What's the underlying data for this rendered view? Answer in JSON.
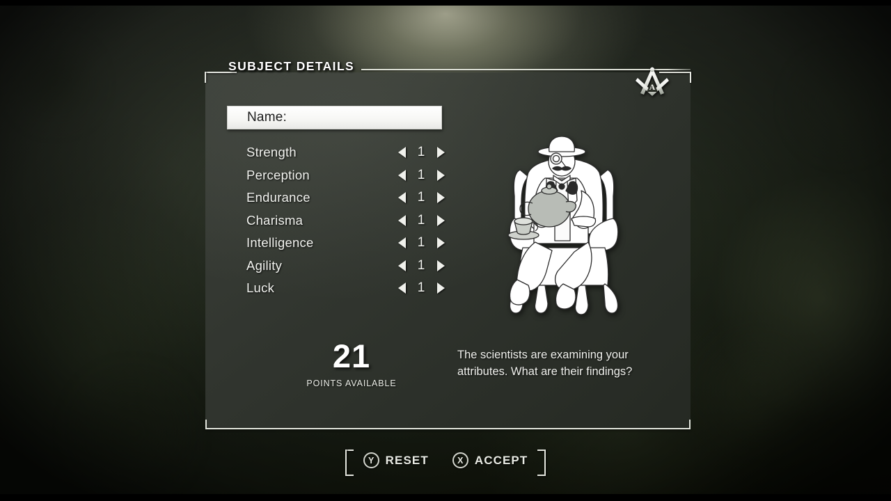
{
  "panel": {
    "title": "SUBJECT DETAILS",
    "emblem_icon": "masonic-square-compass-icon",
    "emblem_center_letter": "A"
  },
  "name_field": {
    "label": "Name:",
    "value": "",
    "placeholder": ""
  },
  "stats": {
    "decrement_icon": "arrow-left-icon",
    "increment_icon": "arrow-right-icon",
    "rows": [
      {
        "label": "Strength",
        "value": "1"
      },
      {
        "label": "Perception",
        "value": "1"
      },
      {
        "label": "Endurance",
        "value": "1"
      },
      {
        "label": "Charisma",
        "value": "1"
      },
      {
        "label": "Intelligence",
        "value": "1"
      },
      {
        "label": "Agility",
        "value": "1"
      },
      {
        "label": "Luck",
        "value": "1"
      }
    ]
  },
  "portrait": {
    "icon": "seated-gentleman-with-teapot-illustration"
  },
  "points": {
    "number": "21",
    "caption": "POINTS AVAILABLE"
  },
  "description": {
    "text": "The scientists are examining your attributes. What are their findings?"
  },
  "prompts": [
    {
      "button": "Y",
      "label": "RESET"
    },
    {
      "button": "X",
      "label": "ACCEPT"
    }
  ],
  "colors": {
    "panel_bg": "#35392f",
    "border": "#e3e6dd",
    "text": "#f2f3ef",
    "field_bg": "#ffffff",
    "field_text": "#1c1c1c"
  }
}
